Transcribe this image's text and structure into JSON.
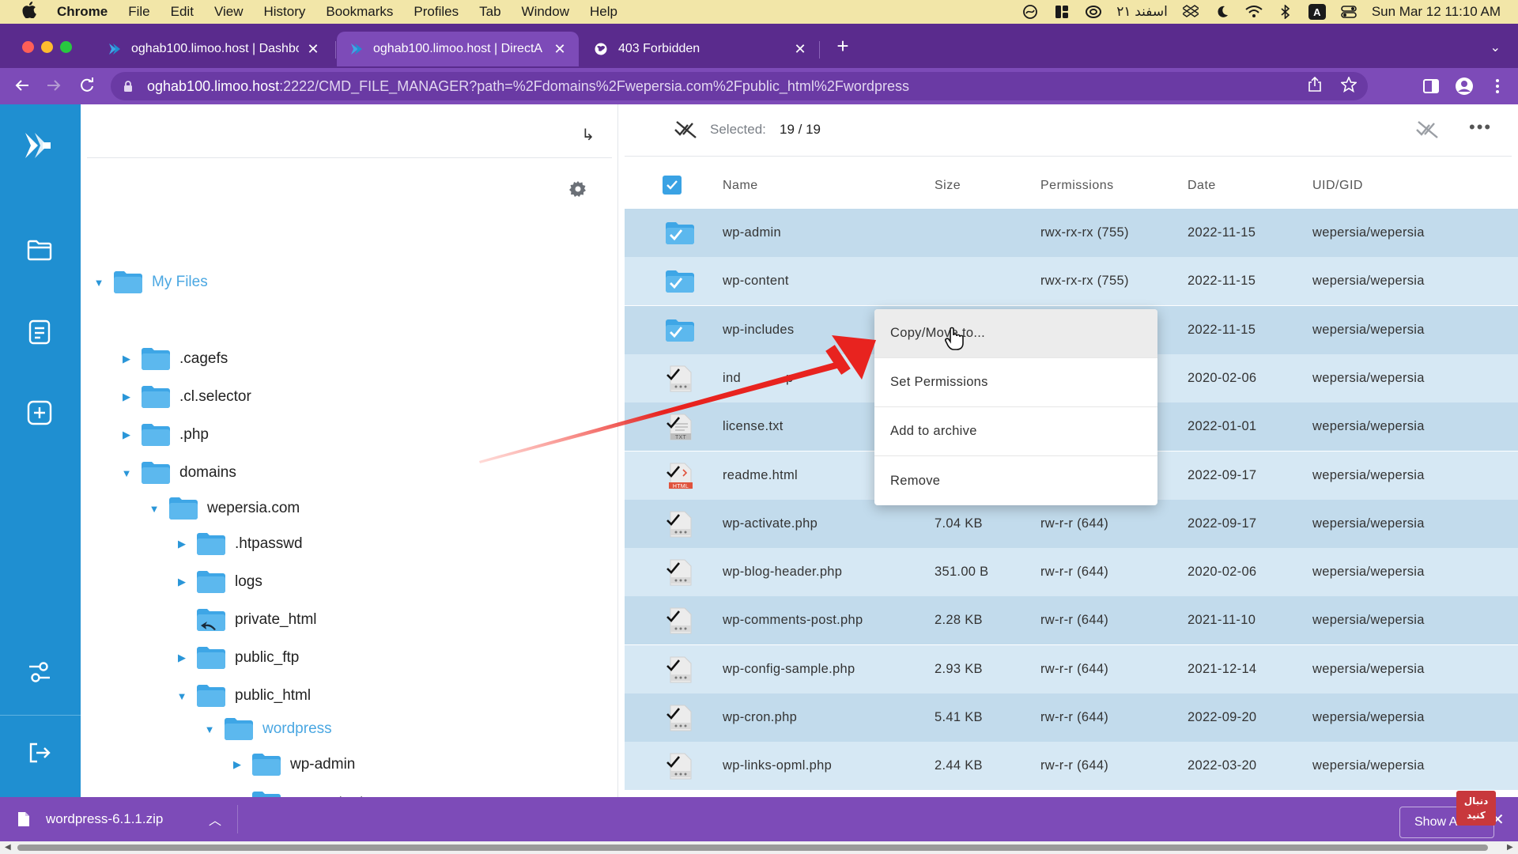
{
  "menubar": {
    "app": "Chrome",
    "items": [
      "File",
      "Edit",
      "View",
      "History",
      "Bookmarks",
      "Profiles",
      "Tab",
      "Window",
      "Help"
    ],
    "persian_date": "۲۱ اسفند",
    "keyboard_input": "A",
    "datetime": "Sun Mar 12  11:10 AM"
  },
  "tabs": [
    {
      "title": "oghab100.limoo.host | Dashboa",
      "icon": "directadmin-icon",
      "close": "✕"
    },
    {
      "title": "oghab100.limoo.host | DirectA",
      "icon": "directadmin-icon",
      "close": "✕"
    },
    {
      "title": "403 Forbidden",
      "icon": "globe-icon",
      "close": "✕"
    }
  ],
  "toolbar": {
    "url_host": "oghab100.limoo.host",
    "url_path": ":2222/CMD_FILE_MANAGER?path=%2Fdomains%2Fwepersia.com%2Fpublic_html%2Fwordpress"
  },
  "tree": {
    "root": "My Files",
    "items": [
      {
        "label": ".cagefs",
        "level": 1,
        "caret": "▶"
      },
      {
        "label": ".cl.selector",
        "level": 1,
        "caret": "▶"
      },
      {
        "label": ".php",
        "level": 1,
        "caret": "▶"
      },
      {
        "label": "domains",
        "level": 1,
        "caret": "▼"
      },
      {
        "label": "wepersia.com",
        "level": 2,
        "caret": "▼"
      },
      {
        "label": ".htpasswd",
        "level": 3,
        "caret": "▶"
      },
      {
        "label": "logs",
        "level": 3,
        "caret": "▶"
      },
      {
        "label": "private_html",
        "level": 3,
        "caret": ""
      },
      {
        "label": "public_ftp",
        "level": 3,
        "caret": "▶"
      },
      {
        "label": "public_html",
        "level": 3,
        "caret": "▼"
      },
      {
        "label": "wordpress",
        "level": 4,
        "caret": "▼"
      },
      {
        "label": "wp-admin",
        "level": 5,
        "caret": "▶"
      },
      {
        "label": "wp-content",
        "level": 5,
        "caret": "▶"
      }
    ]
  },
  "selection": {
    "label": "Selected:",
    "count": "19 / 19"
  },
  "columns": {
    "name": "Name",
    "size": "Size",
    "permissions": "Permissions",
    "date": "Date",
    "uid": "UID/GID"
  },
  "files": [
    {
      "name": "wp-admin",
      "type": "folder",
      "size": "",
      "perm": "rwx-rx-rx (755)",
      "date": "2022-11-15",
      "uid": "wepersia/wepersia"
    },
    {
      "name": "wp-content",
      "type": "folder",
      "size": "",
      "perm": "rwx-rx-rx (755)",
      "date": "2022-11-15",
      "uid": "wepersia/wepersia"
    },
    {
      "name": "wp-includes",
      "type": "folder",
      "size": "",
      "perm": ")",
      "date": "2022-11-15",
      "uid": "wepersia/wepersia"
    },
    {
      "name": "ind",
      "name_tail": "p",
      "type": "php",
      "size": "",
      "perm": "",
      "date": "2020-02-06",
      "uid": "wepersia/wepersia"
    },
    {
      "name": "license.txt",
      "type": "txt",
      "size": "",
      "perm": "",
      "date": "2022-01-01",
      "uid": "wepersia/wepersia"
    },
    {
      "name": "readme.html",
      "type": "html",
      "size": "",
      "perm": "",
      "date": "2022-09-17",
      "uid": "wepersia/wepersia"
    },
    {
      "name": "wp-activate.php",
      "type": "php",
      "size": "7.04 KB",
      "perm": "rw-r-r (644)",
      "date": "2022-09-17",
      "uid": "wepersia/wepersia"
    },
    {
      "name": "wp-blog-header.php",
      "type": "php",
      "size": "351.00 B",
      "perm": "rw-r-r (644)",
      "date": "2020-02-06",
      "uid": "wepersia/wepersia"
    },
    {
      "name": "wp-comments-post.php",
      "type": "php",
      "size": "2.28 KB",
      "perm": "rw-r-r (644)",
      "date": "2021-11-10",
      "uid": "wepersia/wepersia"
    },
    {
      "name": "wp-config-sample.php",
      "type": "php",
      "size": "2.93 KB",
      "perm": "rw-r-r (644)",
      "date": "2021-12-14",
      "uid": "wepersia/wepersia"
    },
    {
      "name": "wp-cron.php",
      "type": "php",
      "size": "5.41 KB",
      "perm": "rw-r-r (644)",
      "date": "2022-09-20",
      "uid": "wepersia/wepersia"
    },
    {
      "name": "wp-links-opml.php",
      "type": "php",
      "size": "2.44 KB",
      "perm": "rw-r-r (644)",
      "date": "2022-03-20",
      "uid": "wepersia/wepersia"
    }
  ],
  "context_menu": {
    "items": [
      "Copy/Move to...",
      "Set Permissions",
      "Add to archive",
      "Remove"
    ]
  },
  "download_bar": {
    "filename": "wordpress-6.1.1.zip",
    "show_all": "Show All",
    "close": "✕"
  },
  "colors": {
    "tabstrip": "#5a2b8d",
    "toolbar": "#7d4bb8",
    "sidebar": "#1f8fd1",
    "folder": "#3ea6e6",
    "row_selected": "#c2dbec",
    "arrow": "#e8231f"
  }
}
